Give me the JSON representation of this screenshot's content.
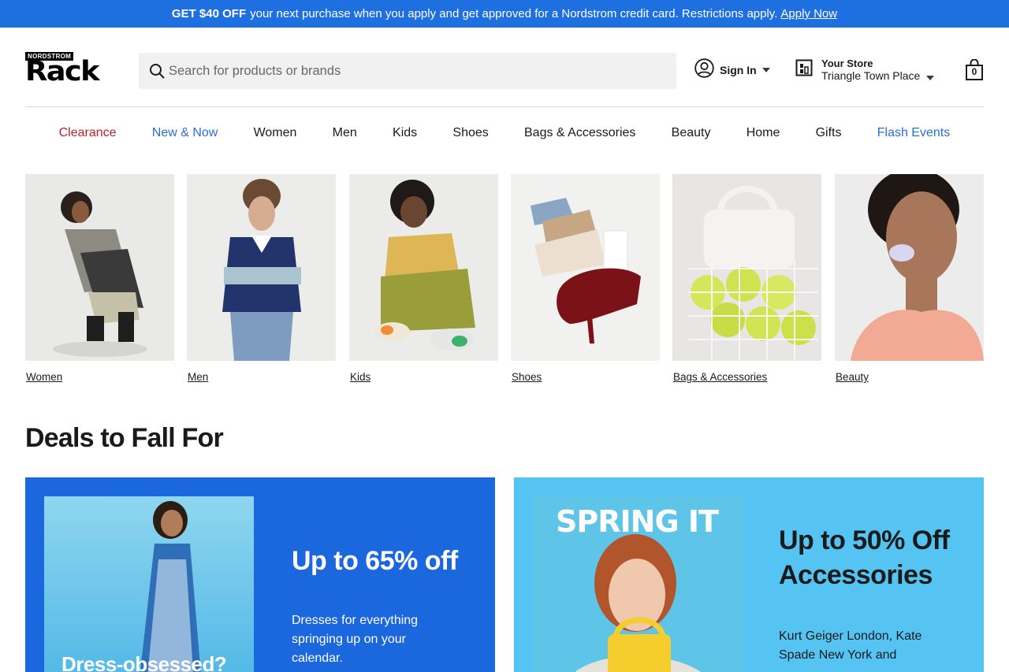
{
  "promo": {
    "bold": "GET $40 OFF",
    "message": "your next purchase when you apply and get approved for a Nordstrom credit card. Restrictions apply.",
    "link": "Apply Now"
  },
  "header": {
    "logo_tag": "NORDSTROM",
    "logo_word": "Rack",
    "search_placeholder": "Search for products or brands",
    "sign_in": "Sign In",
    "store_label": "Your Store",
    "store_name": "Triangle Town Place",
    "bag_count": "0"
  },
  "nav": [
    {
      "label": "Clearance"
    },
    {
      "label": "New & Now"
    },
    {
      "label": "Women"
    },
    {
      "label": "Men"
    },
    {
      "label": "Kids"
    },
    {
      "label": "Shoes"
    },
    {
      "label": "Bags & Accessories"
    },
    {
      "label": "Beauty"
    },
    {
      "label": "Home"
    },
    {
      "label": "Gifts"
    },
    {
      "label": "Flash Events"
    }
  ],
  "categories": [
    {
      "label": "Women"
    },
    {
      "label": "Men"
    },
    {
      "label": "Kids"
    },
    {
      "label": "Shoes"
    },
    {
      "label": "Bags & Accessories"
    },
    {
      "label": "Beauty"
    }
  ],
  "deals": {
    "title": "Deals to Fall For",
    "cards": [
      {
        "headline": "Up to 65% off",
        "body": "Dresses for everything springing up on your calendar.",
        "image_text": "Dress-obsessed?"
      },
      {
        "headline": "Up to 50% Off Accessories",
        "body": "Kurt Geiger London, Kate Spade New York and",
        "image_text": "SPRING IT"
      }
    ]
  },
  "colors": {
    "promo_bg": "#1e6fe0",
    "clearance": "#c41f2b",
    "accent_link": "#2a6fd2",
    "card1_bg": "#1b67dd",
    "card2_bg": "#56c4f2"
  }
}
